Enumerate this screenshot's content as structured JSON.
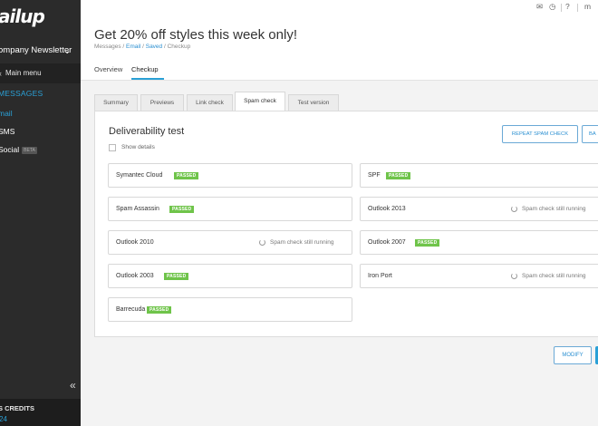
{
  "sidebar": {
    "logo_text": "ailup",
    "account_name": "ompany Newsletter",
    "main_menu_label": "Main menu",
    "section_heading": "MESSAGES",
    "items": [
      {
        "label": "mail"
      },
      {
        "label": "SMS"
      },
      {
        "label": "Social",
        "badge": "BETA"
      }
    ],
    "credits_title": "S CREDITS",
    "credits_value": "24"
  },
  "topbar": {
    "truncated_label": "m"
  },
  "header": {
    "title": "Get 20% off styles this week only!",
    "breadcrumb": {
      "messages": "Messages",
      "sep1": " / ",
      "email": "Email",
      "sep2": " / ",
      "saved": "Saved",
      "sep3": " / ",
      "current": "Checkup"
    },
    "subtabs": [
      "Overview",
      "Checkup"
    ]
  },
  "tabs": [
    "Summary",
    "Previews",
    "Link check",
    "Spam check",
    "Test version"
  ],
  "panel": {
    "title": "Deliverability test",
    "show_details_label": "Show details",
    "repeat_button": "REPEAT SPAM CHECK",
    "second_button": "BA"
  },
  "spam_results": [
    {
      "name": "Symantec Cloud",
      "status": "PASSED"
    },
    {
      "name": "SPF",
      "status": "PASSED"
    },
    {
      "name": "Spam Assassin",
      "status": "PASSED"
    },
    {
      "name": "Outlook 2013",
      "status": "Spam check still running"
    },
    {
      "name": "Outlook 2010",
      "status": "Spam check still running"
    },
    {
      "name": "Outlook 2007",
      "status": "PASSED"
    },
    {
      "name": "Outlook 2003",
      "status": "PASSED"
    },
    {
      "name": "Iron Port",
      "status": "Spam check still running"
    },
    {
      "name": "Barrecuda",
      "status": "PASSED"
    }
  ],
  "footer": {
    "modify_button": "MODIFY"
  },
  "colors": {
    "accent": "#2aa0d6",
    "passed": "#6fc44a",
    "sidebar_bg": "#2b2b2b"
  }
}
